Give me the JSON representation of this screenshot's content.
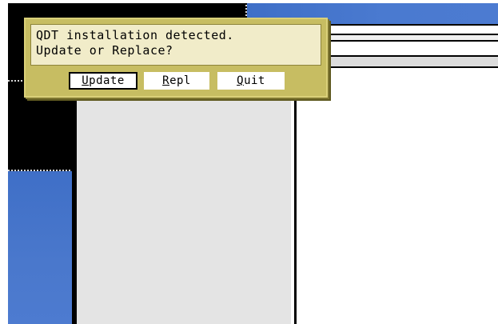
{
  "dialog": {
    "message": "QDT installation detected.\nUpdate or Replace?",
    "buttons": [
      {
        "key": "U",
        "rest": "pdate"
      },
      {
        "key": "R",
        "rest": "epl"
      },
      {
        "key": "Q",
        "rest": "uit"
      }
    ]
  },
  "colors": {
    "dialog_frame": "#c7bd62",
    "dialog_message_bg": "#f1ecc9",
    "desktop_blue": "#4a78cc",
    "panel_gray": "#e4e4e4"
  }
}
